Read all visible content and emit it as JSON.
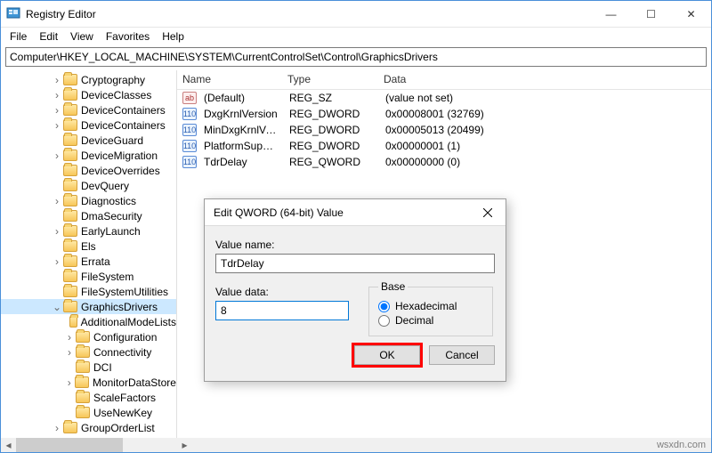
{
  "window": {
    "title": "Registry Editor",
    "controls": {
      "min": "—",
      "max": "☐",
      "close": "✕"
    }
  },
  "menu": [
    "File",
    "Edit",
    "View",
    "Favorites",
    "Help"
  ],
  "address": "Computer\\HKEY_LOCAL_MACHINE\\SYSTEM\\CurrentControlSet\\Control\\GraphicsDrivers",
  "tree": [
    {
      "indent": 4,
      "tw": ">",
      "label": "Cryptography"
    },
    {
      "indent": 4,
      "tw": ">",
      "label": "DeviceClasses"
    },
    {
      "indent": 4,
      "tw": ">",
      "label": "DeviceContainers"
    },
    {
      "indent": 4,
      "tw": ">",
      "label": "DeviceContainers"
    },
    {
      "indent": 4,
      "tw": "",
      "label": "DeviceGuard"
    },
    {
      "indent": 4,
      "tw": ">",
      "label": "DeviceMigration"
    },
    {
      "indent": 4,
      "tw": "",
      "label": "DeviceOverrides"
    },
    {
      "indent": 4,
      "tw": "",
      "label": "DevQuery"
    },
    {
      "indent": 4,
      "tw": ">",
      "label": "Diagnostics"
    },
    {
      "indent": 4,
      "tw": "",
      "label": "DmaSecurity"
    },
    {
      "indent": 4,
      "tw": ">",
      "label": "EarlyLaunch"
    },
    {
      "indent": 4,
      "tw": "",
      "label": "Els"
    },
    {
      "indent": 4,
      "tw": ">",
      "label": "Errata"
    },
    {
      "indent": 4,
      "tw": "",
      "label": "FileSystem"
    },
    {
      "indent": 4,
      "tw": "",
      "label": "FileSystemUtilities"
    },
    {
      "indent": 4,
      "tw": "v",
      "label": "GraphicsDrivers",
      "sel": true
    },
    {
      "indent": 5,
      "tw": "",
      "label": "AdditionalModeLists"
    },
    {
      "indent": 5,
      "tw": ">",
      "label": "Configuration"
    },
    {
      "indent": 5,
      "tw": ">",
      "label": "Connectivity"
    },
    {
      "indent": 5,
      "tw": "",
      "label": "DCI"
    },
    {
      "indent": 5,
      "tw": ">",
      "label": "MonitorDataStore"
    },
    {
      "indent": 5,
      "tw": "",
      "label": "ScaleFactors"
    },
    {
      "indent": 5,
      "tw": "",
      "label": "UseNewKey"
    },
    {
      "indent": 4,
      "tw": ">",
      "label": "GroupOrderList"
    }
  ],
  "columns": {
    "name": "Name",
    "type": "Type",
    "data": "Data"
  },
  "values": [
    {
      "icon": "str",
      "name": "(Default)",
      "type": "REG_SZ",
      "data": "(value not set)"
    },
    {
      "icon": "bin",
      "name": "DxgKrnlVersion",
      "type": "REG_DWORD",
      "data": "0x00008001 (32769)"
    },
    {
      "icon": "bin",
      "name": "MinDxgKrnlVersi...",
      "type": "REG_DWORD",
      "data": "0x00005013 (20499)"
    },
    {
      "icon": "bin",
      "name": "PlatformSuppor...",
      "type": "REG_DWORD",
      "data": "0x00000001 (1)"
    },
    {
      "icon": "bin",
      "name": "TdrDelay",
      "type": "REG_QWORD",
      "data": "0x00000000 (0)"
    }
  ],
  "dialog": {
    "title": "Edit QWORD (64-bit) Value",
    "name_label": "Value name:",
    "name_value": "TdrDelay",
    "data_label": "Value data:",
    "data_value": "8",
    "base_label": "Base",
    "hex_label": "Hexadecimal",
    "dec_label": "Decimal",
    "ok": "OK",
    "cancel": "Cancel"
  },
  "watermark": "wsxdn.com"
}
